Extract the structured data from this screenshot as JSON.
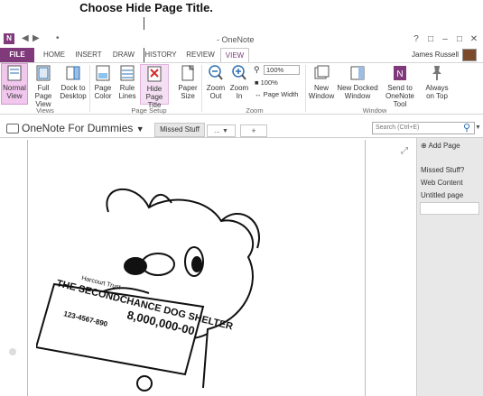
{
  "callout": "Choose Hide Page Title.",
  "window": {
    "title": "- OneNote",
    "qat": [
      "◀",
      "▶",
      "•"
    ],
    "controls": [
      "?",
      "□",
      "–",
      "□",
      "✕"
    ]
  },
  "tabs": {
    "file": "FILE",
    "items": [
      "HOME",
      "INSERT",
      "DRAW",
      "HISTORY",
      "REVIEW",
      "VIEW"
    ],
    "active": "VIEW"
  },
  "user": "James Russell",
  "ribbon": {
    "views": {
      "label": "Views",
      "buttons": [
        "Normal View",
        "Full Page View",
        "Dock to Desktop"
      ]
    },
    "page_setup": {
      "label": "Page Setup",
      "buttons": [
        "Page Color",
        "Rule Lines",
        "Hide Page Title",
        "Paper Size"
      ]
    },
    "zoom": {
      "label": "Zoom",
      "buttons": [
        "Zoom Out",
        "Zoom In"
      ],
      "zoom_value": "100%",
      "hundred": "100%",
      "page_width": "Page Width"
    },
    "window": {
      "label": "Window",
      "buttons": [
        "New Window",
        "New Docked Window",
        "Send to OneNote Tool",
        "Always on Top"
      ]
    }
  },
  "notebook": {
    "name": "OneNote For Dummies",
    "section": "Missed Stuff",
    "section2": "...",
    "add": "+",
    "search_placeholder": "Search (Ctrl+E)"
  },
  "pages": {
    "add": "Add Page",
    "items": [
      "Missed Stuff?",
      "Web Content",
      "Untitled page"
    ]
  },
  "illustration": {
    "check_text": "THE SECONDCHANCE DOG SHELTER",
    "bank": "Harcourt Trust",
    "amount": "8,000,000-00",
    "number": "123-4567-890"
  },
  "colors": {
    "accent": "#80397b",
    "highlight": "#f1c7ee"
  }
}
